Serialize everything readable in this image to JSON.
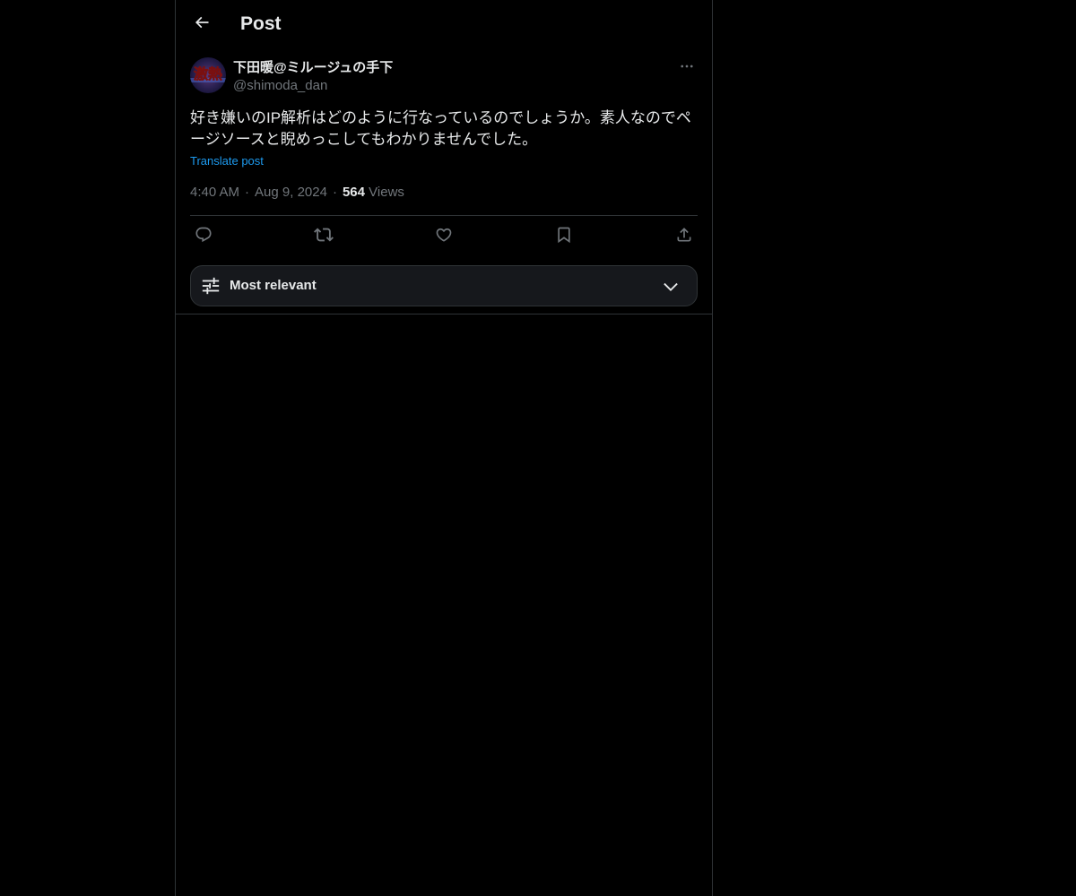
{
  "header": {
    "title": "Post"
  },
  "post": {
    "author_name": "下田暖@ミルージュの手下",
    "author_handle": "@shimoda_dan",
    "avatar_text": "激熱",
    "text": "好き嫌いのIP解析はどのように行なっているのでしょうか。素人なのでペ\nージソースと睨めっこしてもわかりませんでした。",
    "translate_label": "Translate post",
    "time": "4:40 AM",
    "date": "Aug 9, 2024",
    "views_count": "564",
    "views_label": "Views"
  },
  "actions": {
    "icons": [
      "reply-icon",
      "repost-icon",
      "like-icon",
      "bookmark-icon",
      "share-icon"
    ]
  },
  "sort": {
    "label": "Most relevant",
    "icon": "filter-sliders-icon"
  },
  "colors": {
    "background": "#000000",
    "text": "#e7e9ea",
    "muted": "#71767b",
    "link": "#1d9bf0",
    "border": "#2f3336"
  }
}
